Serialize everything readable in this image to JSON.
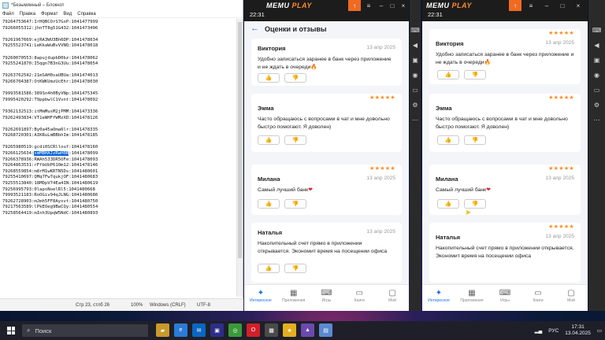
{
  "notepad": {
    "title": "*Безымянный – Блокнот",
    "menu": [
      "Файл",
      "Правка",
      "Формат",
      "Вид",
      "Справка"
    ],
    "lines": [
      "79264753647:IrHQBCOrS7GxP:1041477999",
      "79266055312:jhnTT8g51G432:1041473496",
      "",
      "79261967669:ejRA3WU3Bh6DP:1041478034",
      "79255523741:LeKkaWuBvVVNQ:1041478018",
      "",
      "79260070553:8apujdupbD0bz:1041478062",
      "79255241870:I5qgn7B3nG3Uu:1041478054",
      "",
      "79263762542:21mSAH0saUBUa:1041474013",
      "79266704387:OtKWKUmzUcEhr:1041478030",
      "",
      "79993581586:389Sn4h0ByVNp:1041475345",
      "79995420292:T9ppbwlC1Vvnt:1041478092",
      "",
      "79362132513:itMmMusM2jPMM:1041473336",
      "79262493834:VT1eWHFfWMzXD:1041478126",
      "",
      "79262691897:By0a45aOma6lr:1041478335",
      "79268720301:AIKRuLmBBbhIm:1041478185",
      "",
      "79265980519:gcdi0SCRllouf:1041478160",
      "79266125634:",
      "79266378936:RWAh533DR5OFe:1041478093",
      "79264863531:rFfbUbP610m12:1041478146",
      "79268559854:m8rM1wKRTN5Ds:1041480601",
      "79255410697:QMq7Fw7qukjOF:1041480683",
      "79255513840:18MDpV74Ea4IN:1041480619",
      "79256995793:0lapsNoelRl5:1041480668",
      "79993521183:RoOGiv94qJLNG:1041480686",
      "79262728903:mJmh5FF8Aysvt:1041480750",
      "79217563589:lPkEOeg9BwCQy:1041480554",
      "79258564419:mInh3UpqW5NdC:1041480893"
    ],
    "selected_text": "xmMBHAJzRwH0B",
    "selected_tail": ":1041478099",
    "status": {
      "position": "Стр 23, стлб 26",
      "zoom": "100%",
      "line_endings": "Windows (CRLF)",
      "encoding": "UTF-8"
    }
  },
  "memu_left": {
    "time": "22:31",
    "logo_a": "MEMU ",
    "logo_b": "PLAY",
    "page_title": "Оценки и отзывы",
    "reviews": [
      {
        "name": "Виктория",
        "date": "13 апр 2025",
        "stars": "",
        "text": "Удобно записаться заранее в банк через приложение и не ждать в очереди",
        "emoji": "🔥"
      },
      {
        "name": "Эмма",
        "date": "13 апр 2025",
        "stars": "★★★★★",
        "text": "Часто обращаюсь с вопросами в чат и мне довольно быстро помогают. Я доволен)",
        "emoji": ""
      },
      {
        "name": "Милана",
        "date": "13 апр 2025",
        "stars": "★★★★★",
        "text": "Самый лучший банк",
        "emoji": "❤"
      },
      {
        "name": "Наталья",
        "date": "13 апр 2025",
        "stars": "★★★★★",
        "text": "Накопительный счет прямо в приложении открывается. Экономит время на посещении офиса",
        "emoji": ""
      }
    ],
    "nav": [
      "Интересное",
      "Приложения",
      "Игры",
      "Книги",
      "Мой"
    ]
  },
  "memu_right": {
    "time": "22:31",
    "logo_a": "MEMU ",
    "logo_b": "PLAY",
    "reviews": [
      {
        "name": "Виктория",
        "date": "13 апр 2025",
        "stars": "★★★★★",
        "text": "Удобно записаться заранее в банк через приложение и не ждать в очереди",
        "emoji": "🔥"
      },
      {
        "name": "Эмма",
        "date": "13 апр 2025",
        "stars": "★★★★★",
        "text": "Часто обращаюсь с вопросами в чат и мне довольно быстро помогают. Я доволен)",
        "emoji": ""
      },
      {
        "name": "Милана",
        "date": "13 апр 2025",
        "stars": "★★★★★",
        "text": "Самый лучший банк",
        "emoji": "❤"
      },
      {
        "name": "Наталья",
        "date": "13 апр 2025",
        "stars": "★★★★★",
        "text": "Накопительный счет прямо в приложении открывается. Экономит время на посещении офиса",
        "emoji": ""
      }
    ],
    "nav": [
      "Интересное",
      "Приложения",
      "Игры",
      "Книги",
      "Мой"
    ]
  },
  "taskbar": {
    "search_placeholder": "Поиск",
    "lang": "РУС",
    "time": "17:31",
    "date": "13.04.2025"
  },
  "colors": {
    "accent": "#1b6fe0",
    "star": "#ff8a1f",
    "memu_orange": "#f06a22"
  }
}
